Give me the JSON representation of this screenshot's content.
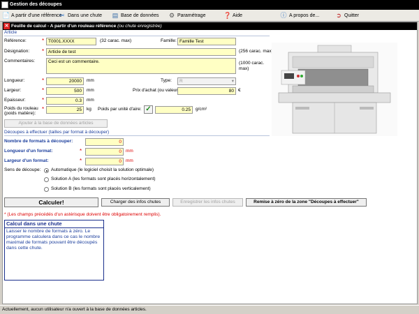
{
  "window": {
    "title": "Gestion des découpes"
  },
  "menu": [
    {
      "label": "A partir d'une référence",
      "icon": "document-arrow-icon"
    },
    {
      "label": "Dans une chute",
      "icon": "scissors-icon"
    },
    {
      "label": "Base de données",
      "icon": "database-icon"
    },
    {
      "label": "Paramétrage",
      "icon": "settings-icon"
    },
    {
      "label": "Aide",
      "icon": "help-icon"
    },
    {
      "label": "A propos de...",
      "icon": "info-icon"
    },
    {
      "label": "Quitter",
      "icon": "exit-icon"
    }
  ],
  "panel": {
    "title": "Feuille de calcul - A partir d'un rouleau référence",
    "subtitle": "(ou chute enregistrée)"
  },
  "article": {
    "section_label": "Article",
    "reference_label": "Référence:",
    "reference_value": "T0001.XXXX",
    "reference_hint": "(32 carac. max)",
    "famille_label": "Famille:",
    "famille_value": "Famille Test",
    "designation_label": "Désignation:",
    "designation_value": "Article de test",
    "designation_hint": "(256 carac. max)",
    "commentaires_label": "Commentaires:",
    "commentaires_value": "Ceci est un commentaire.",
    "commentaires_hint": "(1000 carac. max)",
    "longueur_label": "Longueur:",
    "longueur_value": "20000",
    "longueur_unit": "mm",
    "type_label": "Type:",
    "type_value": "R",
    "largeur_label": "Largeur:",
    "largeur_value": "500",
    "largeur_unit": "mm",
    "prix_label": "Prix d'achat (ou valeur):",
    "prix_value": "80",
    "prix_unit": "€",
    "epaisseur_label": "Epaisseur:",
    "epaisseur_value": "0.3",
    "epaisseur_unit": "mm",
    "poids_label_1": "Poids du rouleau",
    "poids_label_2": "(poids matière):",
    "poids_value": "25",
    "poids_unit": "kg",
    "ppa_label": "Poids par unité d'aire:",
    "ppa_value": "0.25",
    "ppa_unit": "g/cm²",
    "add_db_button": "Ajouter à la base de données articles"
  },
  "decoupes": {
    "section_label": "Découpes à effectuer (tailles par format à découper)",
    "nb_label": "Nombre de formats à découper:",
    "nb_value": "0",
    "longueur_label": "Longueur d'un format:",
    "longueur_value": "0",
    "longueur_unit": "mm",
    "largeur_label": "Largeur d'un format:",
    "largeur_value": "0",
    "largeur_unit": "mm",
    "sens_label": "Sens de découpe:",
    "options": [
      "Automatique (le logiciel choisit la solution optimale)",
      "Solution A (les formats sont placés horizontalement)",
      "Solution B (les formats sont placés verticalement)"
    ],
    "selected_option": 0
  },
  "buttons": {
    "calculer": "Calculer!",
    "charger": "Charger des infos chutes",
    "enregistrer": "Enregistrer les infos chutes",
    "reset": "Remise à zéro de la zone \"Découpes à effectuer\""
  },
  "note": "* (Les champs précédés d'un astérisque doivent être obligatoirement remplis).",
  "help": {
    "title": "Calcul dans une chute",
    "body": "Laisser le nombre de formats à zéro. Le programme calculera dans ce cas le nombre maximal de formats pouvant être découpés dans cette chute."
  },
  "status": "Actuellement, aucun utilisateur n'a ouvert à la base de données articles."
}
